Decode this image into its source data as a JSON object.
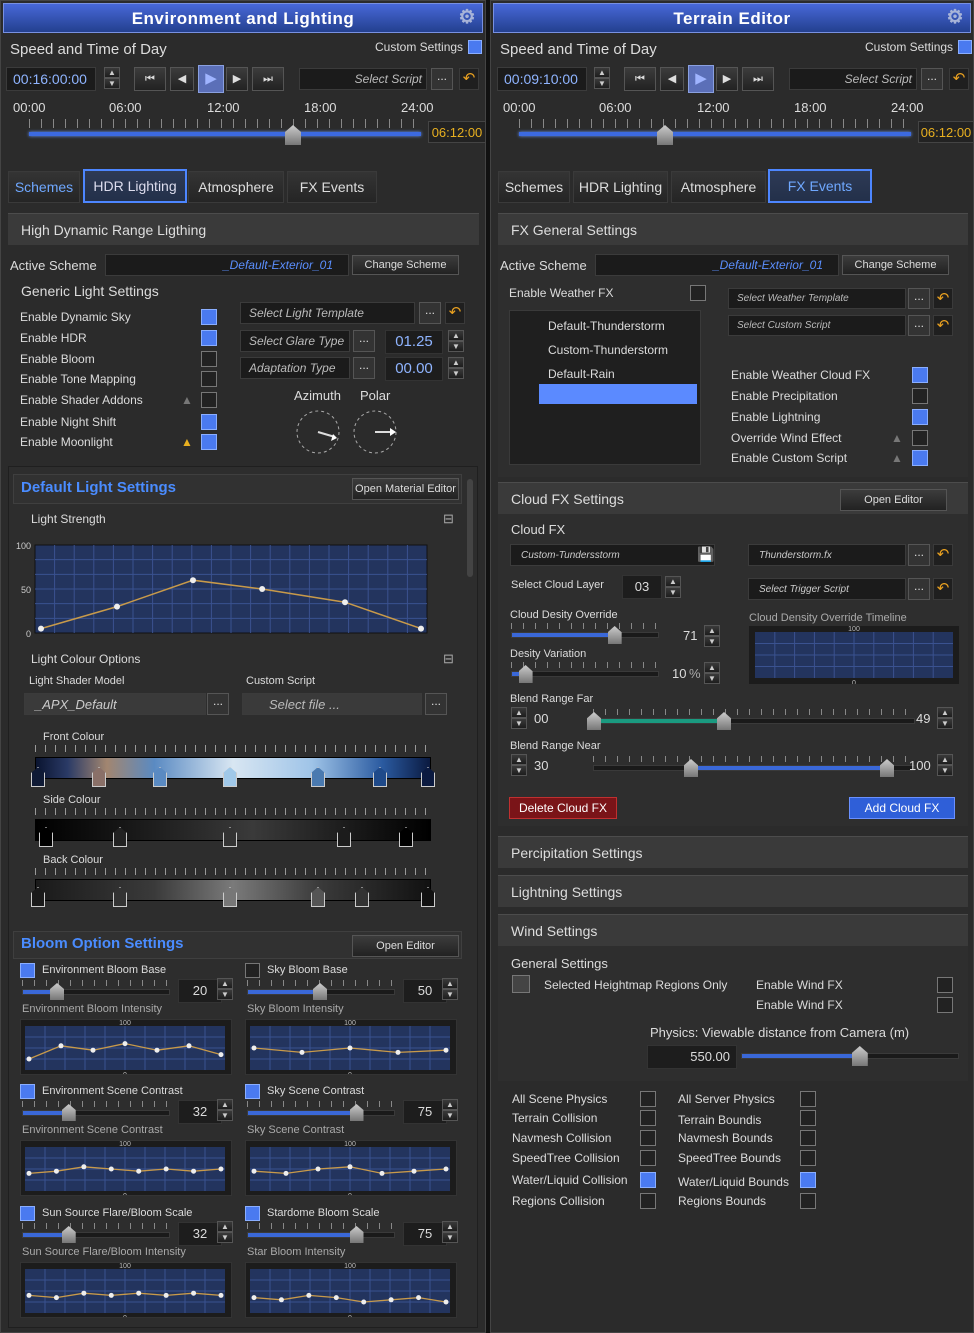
{
  "left": {
    "title": "Environment and Lighting",
    "speed_time": "Speed and Time of Day",
    "custom_settings": "Custom Settings",
    "time_value": "00:16:00:00",
    "select_script": "Select Script",
    "dots": "...",
    "timeline_labels": [
      "00:00",
      "06:00",
      "12:00",
      "18:00",
      "24:00"
    ],
    "time_readout": "06:12:00",
    "tabs": [
      "Schemes",
      "HDR Lighting",
      "Atmosphere",
      "FX Events"
    ],
    "hdr_section": "High Dynamic Range Ligthing",
    "active_scheme_label": "Active Scheme",
    "active_scheme_value": "_Default-Exterior_01",
    "change_scheme": "Change Scheme",
    "generic_title": "Generic Light Settings",
    "generic_items": [
      {
        "label": "Enable Dynamic Sky",
        "on": true,
        "warn": false
      },
      {
        "label": "Enable HDR",
        "on": true,
        "warn": false
      },
      {
        "label": "Enable Bloom",
        "on": false,
        "warn": false
      },
      {
        "label": "Enable Tone Mapping",
        "on": false,
        "warn": false
      },
      {
        "label": "Enable Shader Addons",
        "on": false,
        "warn": "gray"
      },
      {
        "label": "Enable Night Shift",
        "on": true,
        "warn": false
      },
      {
        "label": "Enable Moonlight",
        "on": true,
        "warn": "yellow"
      }
    ],
    "select_light_template": "Select Light Template",
    "select_glare_type": "Select Glare Type",
    "glare_value": "01.25",
    "adaptation_type": "Adaptation Type",
    "adaptation_value": "00.00",
    "azimuth": "Azimuth",
    "polar": "Polar",
    "default_light_title": "Default Light Settings",
    "open_material_editor": "Open Material Editor",
    "light_strength": "Light Strength",
    "light_strength_chart": {
      "type": "line",
      "y_ticks": [
        "100",
        "50",
        "0"
      ],
      "ylim": [
        0,
        100
      ],
      "values": [
        5,
        30,
        60,
        50,
        35,
        5
      ]
    },
    "light_colour_options": "Light Colour Options",
    "light_shader_model": "Light Shader Model",
    "custom_script": "Custom Script",
    "shader_value": "_APX_Default",
    "select_file": "Select file ...",
    "front_colour": "Front Colour",
    "side_colour": "Side Colour",
    "back_colour": "Back Colour",
    "bloom_title": "Bloom Option Settings",
    "open_editor": "Open Editor",
    "bloom_blocks": [
      {
        "label": "Environment Bloom Base",
        "on": true,
        "value": "20",
        "fill": 0.24,
        "sub": "Environment Bloom Intensity",
        "y_ticks": [
          "100",
          "0"
        ],
        "values": [
          25,
          55,
          45,
          60,
          45,
          55,
          35
        ]
      },
      {
        "label": "Sky Bloom Base",
        "on": false,
        "value": "50",
        "fill": 0.5,
        "sub": "Sky Bloom Intensity",
        "y_ticks": [
          "100",
          "0"
        ],
        "values": [
          50,
          40,
          50,
          40,
          45
        ]
      },
      {
        "label": "Environment Scene Contrast",
        "on": true,
        "value": "32",
        "fill": 0.32,
        "sub": "Environment Scene Contrast",
        "y_ticks": [
          "100",
          "0"
        ],
        "values": [
          40,
          45,
          55,
          50,
          45,
          50,
          45,
          50
        ]
      },
      {
        "label": "Sky Scene Contrast",
        "on": true,
        "value": "75",
        "fill": 0.75,
        "sub": "Sky Scene Contrast",
        "y_ticks": [
          "100",
          "0"
        ],
        "values": [
          45,
          40,
          50,
          55,
          40,
          45,
          50
        ]
      },
      {
        "label": "Sun Source Flare/Bloom Scale",
        "on": true,
        "value": "32",
        "fill": 0.32,
        "sub": "Sun Source Flare/Bloom Intensity",
        "y_ticks": [
          "100",
          "0"
        ],
        "values": [
          40,
          35,
          45,
          40,
          45,
          40,
          45,
          40
        ]
      },
      {
        "label": "Stardome Bloom Scale",
        "on": true,
        "value": "75",
        "fill": 0.75,
        "sub": "Star Bloom Intensity",
        "y_ticks": [
          "100",
          "0"
        ],
        "values": [
          35,
          30,
          40,
          35,
          25,
          30,
          35,
          25
        ]
      }
    ]
  },
  "right": {
    "title": "Terrain Editor",
    "speed_time": "Speed and Time of Day",
    "custom_settings": "Custom Settings",
    "time_value": "00:09:10:00",
    "select_script": "Select Script",
    "dots": "...",
    "timeline_labels": [
      "00:00",
      "06:00",
      "12:00",
      "18:00",
      "24:00"
    ],
    "time_readout": "06:12:00",
    "tabs": [
      "Schemes",
      "HDR Lighting",
      "Atmosphere",
      "FX Events"
    ],
    "fx_general": "FX General Settings",
    "active_scheme_label": "Active Scheme",
    "active_scheme_value": "_Default-Exterior_01",
    "change_scheme": "Change Scheme",
    "enable_weather_fx": "Enable Weather FX",
    "weather_list": [
      "Default-Thunderstorm",
      "Custom-Thunderstorm",
      "Default-Rain"
    ],
    "select_weather_template": "Select Weather Template",
    "select_custom_script": "Select Custom Script",
    "fx_items": [
      {
        "label": "Enable Weather Cloud FX",
        "on": true,
        "warn": false
      },
      {
        "label": "Enable Precipitation",
        "on": false,
        "warn": false
      },
      {
        "label": "Enable Lightning",
        "on": true,
        "warn": false
      },
      {
        "label": "Override Wind Effect",
        "on": false,
        "warn": true
      },
      {
        "label": "Enable Custom Script",
        "on": true,
        "warn": true
      }
    ],
    "cloud_fx_settings": "Cloud FX Settings",
    "open_editor": "Open Editor",
    "cloud_fx": "Cloud FX",
    "cloud_file": "Custom-Tundersstorm",
    "thunderstorm_fx": "Thunderstorm.fx",
    "select_cloud_layer": "Select Cloud Layer",
    "cloud_layer_value": "03",
    "select_trigger_script": "Select Trigger Script",
    "cloud_density_override": "Cloud Desity Override",
    "density_value": "71",
    "density_fill": 0.71,
    "desity_variation": "Desity Variation",
    "variation_value": "10",
    "variation_unit": "%",
    "variation_fill": 0.1,
    "density_timeline": "Cloud Density Override Timeline",
    "density_timeline_ticks": [
      "100",
      "0"
    ],
    "blend_far": "Blend Range Far",
    "blend_far_lo": "00",
    "blend_far_hi": "49",
    "blend_near": "Blend Range Near",
    "blend_near_lo": "30",
    "blend_near_hi": "100",
    "delete_cloud_fx": "Delete Cloud FX",
    "add_cloud_fx": "Add Cloud FX",
    "percipitation": "Percipitation Settings",
    "lightning": "Lightning Settings",
    "wind": "Wind Settings",
    "general_settings": "General Settings",
    "selected_heightmap": "Selected Heightmap Regions Only",
    "enable_wind_fx_1": "Enable Wind FX",
    "enable_wind_fx_2": "Enable Wind FX",
    "physics_distance": "Physics: Viewable distance from Camera  (m)",
    "distance_value": "550.00",
    "distance_fill": 0.55,
    "physics_left": [
      {
        "label": "All Scene Physics",
        "on": false
      },
      {
        "label": "Terrain Collision",
        "on": false
      },
      {
        "label": "Navmesh Collision",
        "on": false
      },
      {
        "label": "SpeedTree Collision",
        "on": false
      },
      {
        "label": "Water/Liquid Collision",
        "on": true
      },
      {
        "label": "Regions Collision",
        "on": false
      }
    ],
    "physics_right": [
      {
        "label": "All Server Physics",
        "on": false
      },
      {
        "label": "Terrain Boundis",
        "on": false
      },
      {
        "label": "Navmesh Bounds",
        "on": false
      },
      {
        "label": "SpeedTree Bounds",
        "on": false
      },
      {
        "label": "Water/Liquid  Bounds",
        "on": true
      },
      {
        "label": "Regions Bounds",
        "on": false
      }
    ]
  }
}
